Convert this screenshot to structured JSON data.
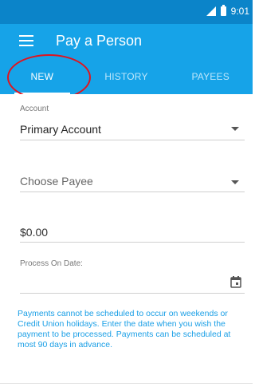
{
  "status_bar": {
    "time": "9:01",
    "icons": [
      "signal-icon",
      "battery-icon"
    ]
  },
  "app_bar": {
    "title": "Pay a Person",
    "menu_icon": "menu-icon"
  },
  "tabs": [
    {
      "label": "NEW",
      "active": true
    },
    {
      "label": "HISTORY",
      "active": false
    },
    {
      "label": "PAYEES",
      "active": false
    }
  ],
  "form": {
    "account": {
      "label": "Account",
      "value": "Primary Account"
    },
    "payee": {
      "placeholder": "Choose Payee"
    },
    "amount": {
      "value": "$0.00"
    },
    "process_date": {
      "label": "Process On Date:",
      "value": ""
    }
  },
  "info": {
    "text": "Payments cannot be scheduled to occur on weekends or Credit Union holidays. Enter the date when you wish the payment to be processed. Payments can be scheduled at most 90 days in advance."
  },
  "colors": {
    "status_bar": "#0b84c9",
    "app_bar": "#16a3e8",
    "accent_text": "#1a9fe6",
    "annotation": "#e0141e"
  }
}
